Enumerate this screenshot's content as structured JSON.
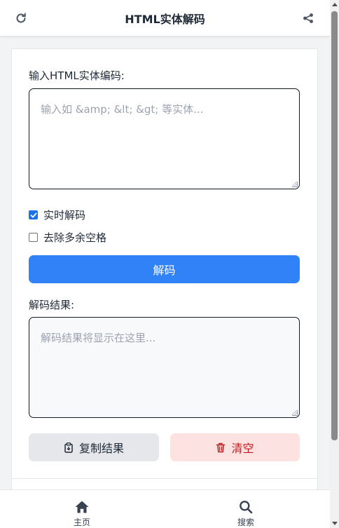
{
  "header": {
    "title": "HTML实体解码",
    "left_icon": "refresh-icon",
    "right_icon": "share-icon"
  },
  "input": {
    "label": "输入HTML实体编码:",
    "placeholder": "输入如 &amp; &lt; &gt; 等实体..."
  },
  "options": {
    "realtime_label": "实时解码",
    "realtime_checked": true,
    "trim_label": "去除多余空格",
    "trim_checked": false
  },
  "decode_button": {
    "label": "解码"
  },
  "output": {
    "label": "解码结果:",
    "placeholder": "解码结果将显示在这里..."
  },
  "actions": {
    "copy_label": "复制结果",
    "clear_label": "清空"
  },
  "bottom_nav": {
    "home_label": "主页",
    "search_label": "搜索"
  },
  "colors": {
    "primary": "#3182f6",
    "danger_bg": "#fde2e2",
    "danger_text": "#b91c1c",
    "neutral_bg": "#e5e7eb"
  }
}
